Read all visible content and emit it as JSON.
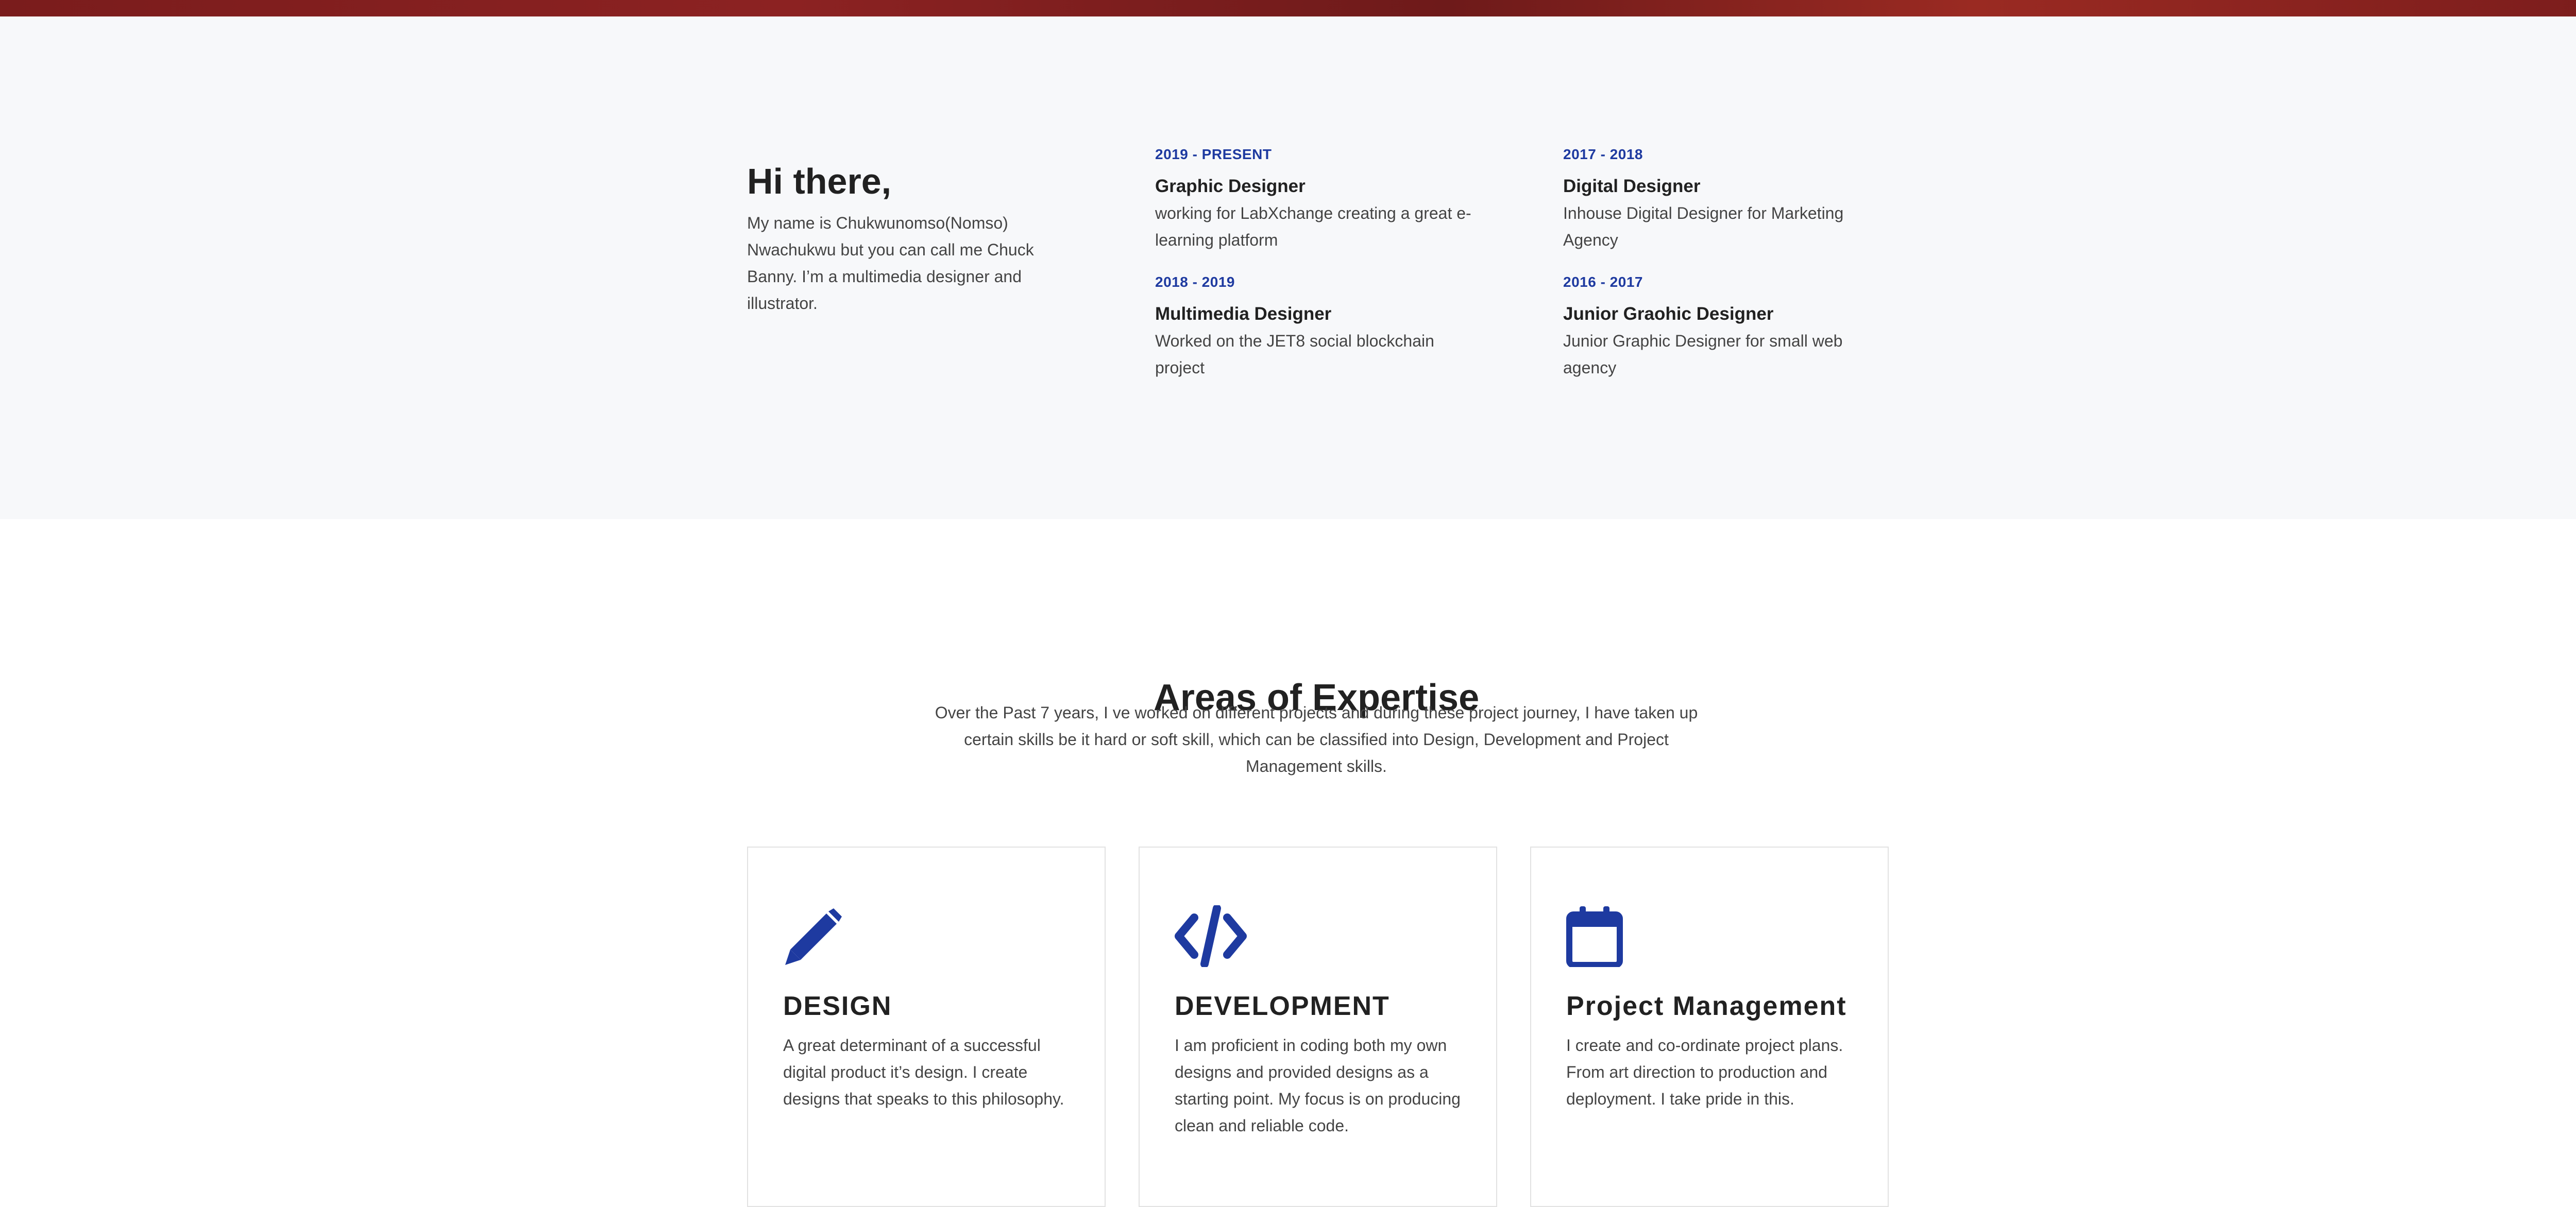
{
  "about": {
    "heading": "Hi there,",
    "intro": "My name is Chukwunomso(Nomso) Nwachukwu but you can call me Chuck Banny. I’m a multimedia designer and illustrator."
  },
  "experience": [
    {
      "dates": "2019 - PRESENT",
      "title": "Graphic Designer",
      "desc": "working for LabXchange creating a great e-learning platform"
    },
    {
      "dates": "2017 - 2018",
      "title": "Digital Designer",
      "desc": "Inhouse Digital Designer for Marketing Agency"
    },
    {
      "dates": "2018 - 2019",
      "title": "Multimedia Designer",
      "desc": "Worked on the JET8 social blockchain project"
    },
    {
      "dates": "2016 - 2017",
      "title": "Junior Graohic Designer",
      "desc": "Junior Graphic Designer for small web agency"
    }
  ],
  "expertise": {
    "title": "Areas of Expertise",
    "subtitle": "Over the Past 7 years, I ve worked on different projects and during these project journey, I have taken up certain skills be it hard or soft skill, which can be classified into Design, Development and Project Management skills.",
    "cards": [
      {
        "icon": "pencil-icon",
        "title": "DESIGN",
        "text": "A great determinant of a successful digital product it’s design. I create designs that speaks to this philosophy."
      },
      {
        "icon": "code-icon",
        "title": "DEVELOPMENT",
        "text": "I am proficient in coding both my own designs and provided designs as a starting point. My focus is on producing clean and reliable code."
      },
      {
        "icon": "calendar-icon",
        "title": "Project Management",
        "text": "I create and co-ordinate project plans. From art direction to production and deployment. I take pride in this."
      }
    ]
  },
  "colors": {
    "accent": "#1e3aa0",
    "about_bg": "#f7f8fa",
    "banner": "#7a1c1c"
  }
}
